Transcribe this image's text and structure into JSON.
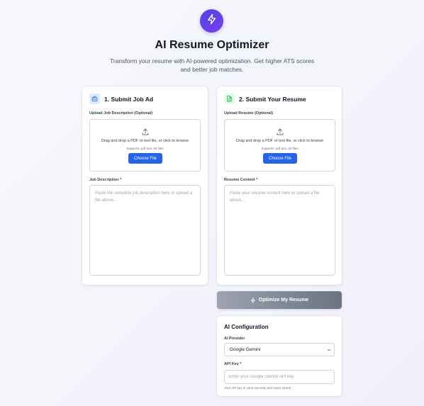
{
  "header": {
    "title": "AI Resume Optimizer",
    "subtitle": "Transform your resume with AI-powered optimization. Get higher ATS scores and better job matches.",
    "logo_icon": "lightning-icon",
    "accent": "#4f46e5"
  },
  "job_card": {
    "title": "1. Submit Job Ad",
    "icon": "briefcase-icon",
    "upload_label": "Upload Job Description (Optional)",
    "dropzone_text": "Drag and drop a PDF or text file, or click to browse",
    "dropzone_hint": "Supports .pdf and .txt files",
    "choose_label": "Choose File",
    "description_label": "Job Description *",
    "description_placeholder": "Paste the complete job description here or upload a file above...",
    "description_value": ""
  },
  "resume_card": {
    "title": "2. Submit Your Resume",
    "icon": "document-icon",
    "upload_label": "Upload Resume (Optional)",
    "dropzone_text": "Drag and drop a PDF or text file, or click to browse",
    "dropzone_hint": "Supports .pdf and .txt files",
    "choose_label": "Choose File",
    "content_label": "Resume Content *",
    "content_placeholder": "Paste your resume content here or upload a file above...",
    "content_value": ""
  },
  "optimize_button": {
    "label": "Optimize My Resume",
    "icon": "lightning-icon"
  },
  "config": {
    "title": "AI Configuration",
    "provider_label": "AI Provider",
    "provider_value": "Google Gemini",
    "api_key_label": "API Key *",
    "api_key_placeholder": "Enter your Google Gemini API key",
    "api_key_value": "",
    "help_text": "Your API key is used securely and never stored"
  },
  "colors": {
    "primary_button": "#2563eb",
    "disabled_button": "#9ca3af"
  }
}
